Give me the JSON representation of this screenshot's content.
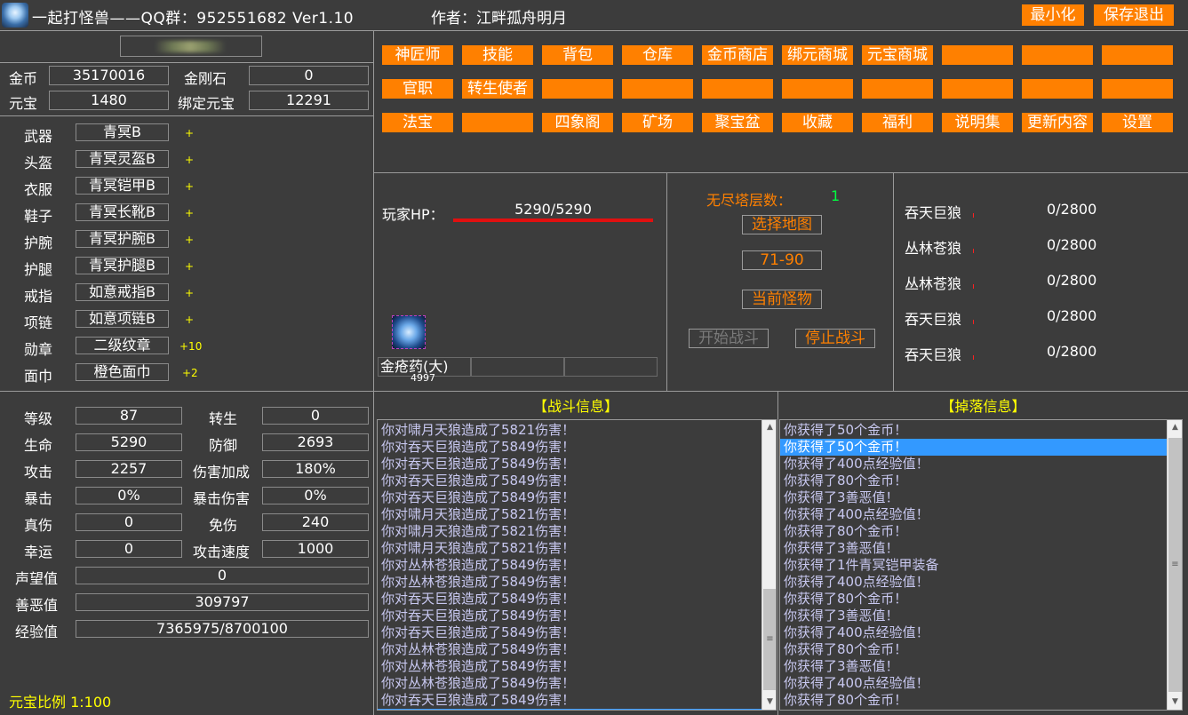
{
  "titlebar": {
    "title": "一起打怪兽——QQ群：952551682 Ver1.10",
    "author": "作者：江畔孤舟明月",
    "minimize_label": "最小化",
    "save_exit_label": "保存退出"
  },
  "currency": {
    "gold_label": "金币",
    "gold_value": "35170016",
    "diamond_label": "金刚石",
    "diamond_value": "0",
    "yuanbao_label": "元宝",
    "yuanbao_value": "1480",
    "bound_yuanbao_label": "绑定元宝",
    "bound_yuanbao_value": "12291"
  },
  "equipment": [
    {
      "slot": "武器",
      "item": "青冥B",
      "bonus": "+"
    },
    {
      "slot": "头盔",
      "item": "青冥灵盔B",
      "bonus": "+"
    },
    {
      "slot": "衣服",
      "item": "青冥铠甲B",
      "bonus": "+"
    },
    {
      "slot": "鞋子",
      "item": "青冥长靴B",
      "bonus": "+"
    },
    {
      "slot": "护腕",
      "item": "青冥护腕B",
      "bonus": "+"
    },
    {
      "slot": "护腿",
      "item": "青冥护腿B",
      "bonus": "+"
    },
    {
      "slot": "戒指",
      "item": "如意戒指B",
      "bonus": "+"
    },
    {
      "slot": "项链",
      "item": "如意项链B",
      "bonus": "+"
    },
    {
      "slot": "勋章",
      "item": "二级纹章",
      "bonus": "+10"
    },
    {
      "slot": "面巾",
      "item": "橙色面巾",
      "bonus": "+2"
    }
  ],
  "stats": {
    "level_label": "等级",
    "level": "87",
    "rebirth_label": "转生",
    "rebirth": "0",
    "hp_label": "生命",
    "hp": "5290",
    "defense_label": "防御",
    "defense": "2693",
    "attack_label": "攻击",
    "attack": "2257",
    "dmg_bonus_label": "伤害加成",
    "dmg_bonus": "180%",
    "crit_label": "暴击",
    "crit": "0%",
    "crit_dmg_label": "暴击伤害",
    "crit_dmg": "0%",
    "true_dmg_label": "真伤",
    "true_dmg": "0",
    "immune_label": "免伤",
    "immune": "240",
    "luck_label": "幸运",
    "luck": "0",
    "atk_speed_label": "攻击速度",
    "atk_speed": "1000",
    "prestige_label": "声望值",
    "prestige": "0",
    "karma_label": "善恶值",
    "karma": "309797",
    "exp_label": "经验值",
    "exp": "7365975/8700100"
  },
  "yuanbao_ratio": "元宝比例 1:100",
  "menu_rows": [
    [
      "神匠师",
      "技能",
      "背包",
      "仓库",
      "金币商店",
      "绑元商城",
      "元宝商城",
      "",
      "",
      ""
    ],
    [
      "官职",
      "转生使者",
      "",
      "",
      "",
      "",
      "",
      "",
      "",
      ""
    ],
    [
      "法宝",
      "",
      "四象阁",
      "矿场",
      "聚宝盆",
      "收藏",
      "福利",
      "说明集",
      "更新内容",
      "设置"
    ]
  ],
  "player": {
    "hp_label": "玩家HP：",
    "hp_value": "5290/5290",
    "hp_fraction": 1.0,
    "potion_name": "金疮药(大)",
    "potion_count": "4997"
  },
  "tower": {
    "floor_label": "无尽塔层数：",
    "floor_value": "1",
    "select_map_label": "选择地图",
    "map_range": "71-90",
    "current_monster_label": "当前怪物",
    "start_label": "开始战斗",
    "stop_label": "停止战斗"
  },
  "monsters": [
    {
      "name": "吞天巨狼",
      "hp": "0/2800"
    },
    {
      "name": "丛林苍狼",
      "hp": "0/2800"
    },
    {
      "name": "丛林苍狼",
      "hp": "0/2800"
    },
    {
      "name": "吞天巨狼",
      "hp": "0/2800"
    },
    {
      "name": "吞天巨狼",
      "hp": "0/2800"
    }
  ],
  "battle_header": "【战斗信息】",
  "drop_header": "【掉落信息】",
  "battle_log": [
    "你对啸月天狼造成了5821伤害！",
    "你对吞天巨狼造成了5849伤害！",
    "你对吞天巨狼造成了5849伤害！",
    "你对吞天巨狼造成了5849伤害！",
    "你对吞天巨狼造成了5849伤害！",
    "你对啸月天狼造成了5821伤害！",
    "你对啸月天狼造成了5821伤害！",
    "你对啸月天狼造成了5821伤害！",
    "你对丛林苍狼造成了5849伤害！",
    "你对丛林苍狼造成了5849伤害！",
    "你对吞天巨狼造成了5849伤害！",
    "你对吞天巨狼造成了5849伤害！",
    "你对吞天巨狼造成了5849伤害！",
    "你对丛林苍狼造成了5849伤害！",
    "你对丛林苍狼造成了5849伤害！",
    "你对丛林苍狼造成了5849伤害！",
    "你对吞天巨狼造成了5849伤害！",
    "你对啸月天狼造成了5821伤害！"
  ],
  "drop_log": [
    "你获得了50个金币！",
    "你获得了50个金币！",
    "你获得了400点经验值！",
    "你获得了80个金币！",
    "你获得了3善恶值！",
    "你获得了400点经验值！",
    "你获得了80个金币！",
    "你获得了3善恶值！",
    "你获得了1件青冥铠甲装备",
    "你获得了400点经验值！",
    "你获得了80个金币！",
    "你获得了3善恶值！",
    "你获得了400点经验值！",
    "你获得了80个金币！",
    "你获得了3善恶值！",
    "你获得了400点经验值！",
    "你获得了80个金币！"
  ]
}
